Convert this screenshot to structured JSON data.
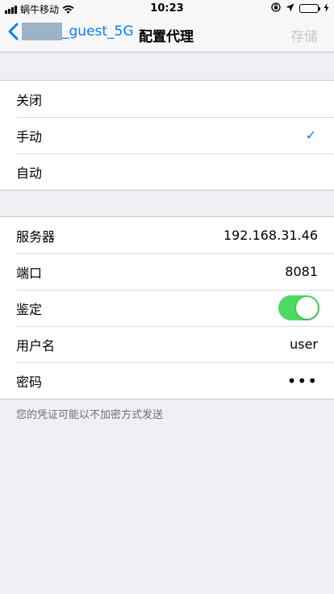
{
  "status_bar": {
    "carrier": "蜗牛移动",
    "time": "10:23"
  },
  "nav": {
    "back_label": "_guest_5G",
    "title": "配置代理",
    "save_label": "存储"
  },
  "proxy_modes": [
    {
      "label": "关闭",
      "selected": false
    },
    {
      "label": "手动",
      "selected": true
    },
    {
      "label": "自动",
      "selected": false
    }
  ],
  "checkmark": "✓",
  "settings": {
    "server_label": "服务器",
    "server_value": "192.168.31.46",
    "port_label": "端口",
    "port_value": "8081",
    "auth_label": "鉴定",
    "auth_enabled": true,
    "username_label": "用户名",
    "username_value": "user",
    "password_label": "密码",
    "password_value": "•••"
  },
  "footnote": "您的凭证可能以不加密方式发送",
  "colors": {
    "accent": "#0a7bff",
    "toggle_on": "#4cd964",
    "background": "#efeff4"
  }
}
